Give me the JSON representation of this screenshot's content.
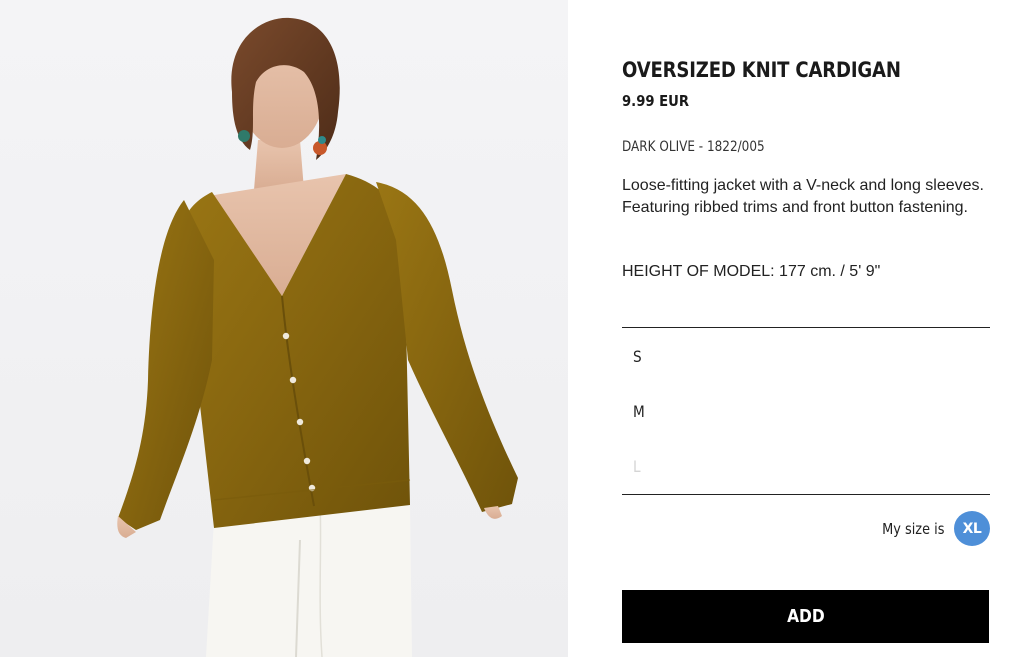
{
  "product": {
    "image_alt": "Model wearing dark olive oversized knit cardigan with white jeans",
    "title": "OVERSIZED KNIT CARDIGAN",
    "price": "9.99 EUR",
    "color_ref": "DARK OLIVE - 1822/005",
    "description": "Loose-fitting jacket with a V-neck and long sleeves. Featuring ribbed trims and front button fastening.",
    "model_height": "HEIGHT OF MODEL: 177 cm. / 5' 9\""
  },
  "sizes": [
    {
      "label": "S",
      "available": true
    },
    {
      "label": "M",
      "available": true
    },
    {
      "label": "L",
      "available": false
    }
  ],
  "my_size": {
    "label": "My size is",
    "value": "XL"
  },
  "actions": {
    "add_label": "ADD"
  },
  "colors": {
    "cardigan": "#8a6a12",
    "badge": "#4e8fd8",
    "button_bg": "#000000"
  }
}
